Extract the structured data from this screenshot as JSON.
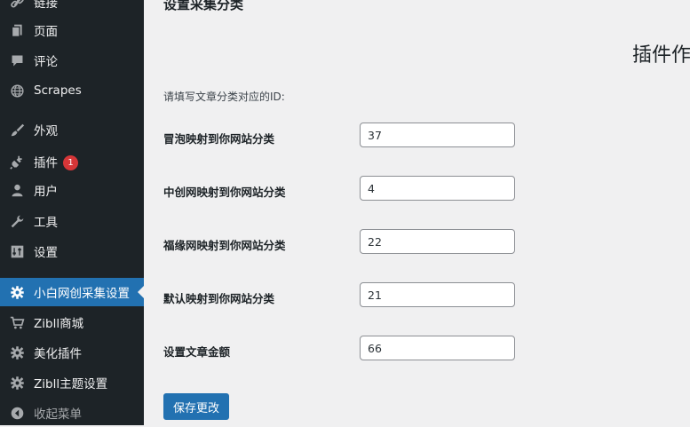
{
  "sidebar": {
    "items": [
      {
        "label": "链接",
        "icon": "link-icon"
      },
      {
        "label": "页面",
        "icon": "page-icon"
      },
      {
        "label": "评论",
        "icon": "comment-icon"
      },
      {
        "label": "Scrapes",
        "icon": "globe-icon"
      },
      {
        "label": "外观",
        "icon": "brush-icon"
      },
      {
        "label": "插件",
        "icon": "plugin-icon",
        "badge": "1"
      },
      {
        "label": "用户",
        "icon": "user-icon"
      },
      {
        "label": "工具",
        "icon": "wrench-icon"
      },
      {
        "label": "设置",
        "icon": "settings-icon"
      },
      {
        "label": "小白网创采集设置",
        "icon": "gear-icon",
        "active": true
      },
      {
        "label": "Zibll商城",
        "icon": "cart-icon"
      },
      {
        "label": "美化插件",
        "icon": "gear-icon"
      },
      {
        "label": "Zibll主题设置",
        "icon": "gear-icon"
      },
      {
        "label": "收起菜单",
        "icon": "collapse-icon"
      }
    ]
  },
  "main": {
    "heading": "设置采集分类",
    "side_title": "插件作",
    "intro": "请填写文章分类对应的ID:",
    "fields": [
      {
        "label": "冒泡映射到你网站分类",
        "value": "37"
      },
      {
        "label": "中创网映射到你网站分类",
        "value": "4"
      },
      {
        "label": "福缘网映射到你网站分类",
        "value": "22"
      },
      {
        "label": "默认映射到你网站分类",
        "value": "21"
      },
      {
        "label": "设置文章金额",
        "value": "66"
      }
    ],
    "save_label": "保存更改"
  },
  "colors": {
    "sidebar_bg": "#1d2327",
    "accent": "#2271b1",
    "badge": "#d63638",
    "page_bg": "#f0f0f1"
  }
}
